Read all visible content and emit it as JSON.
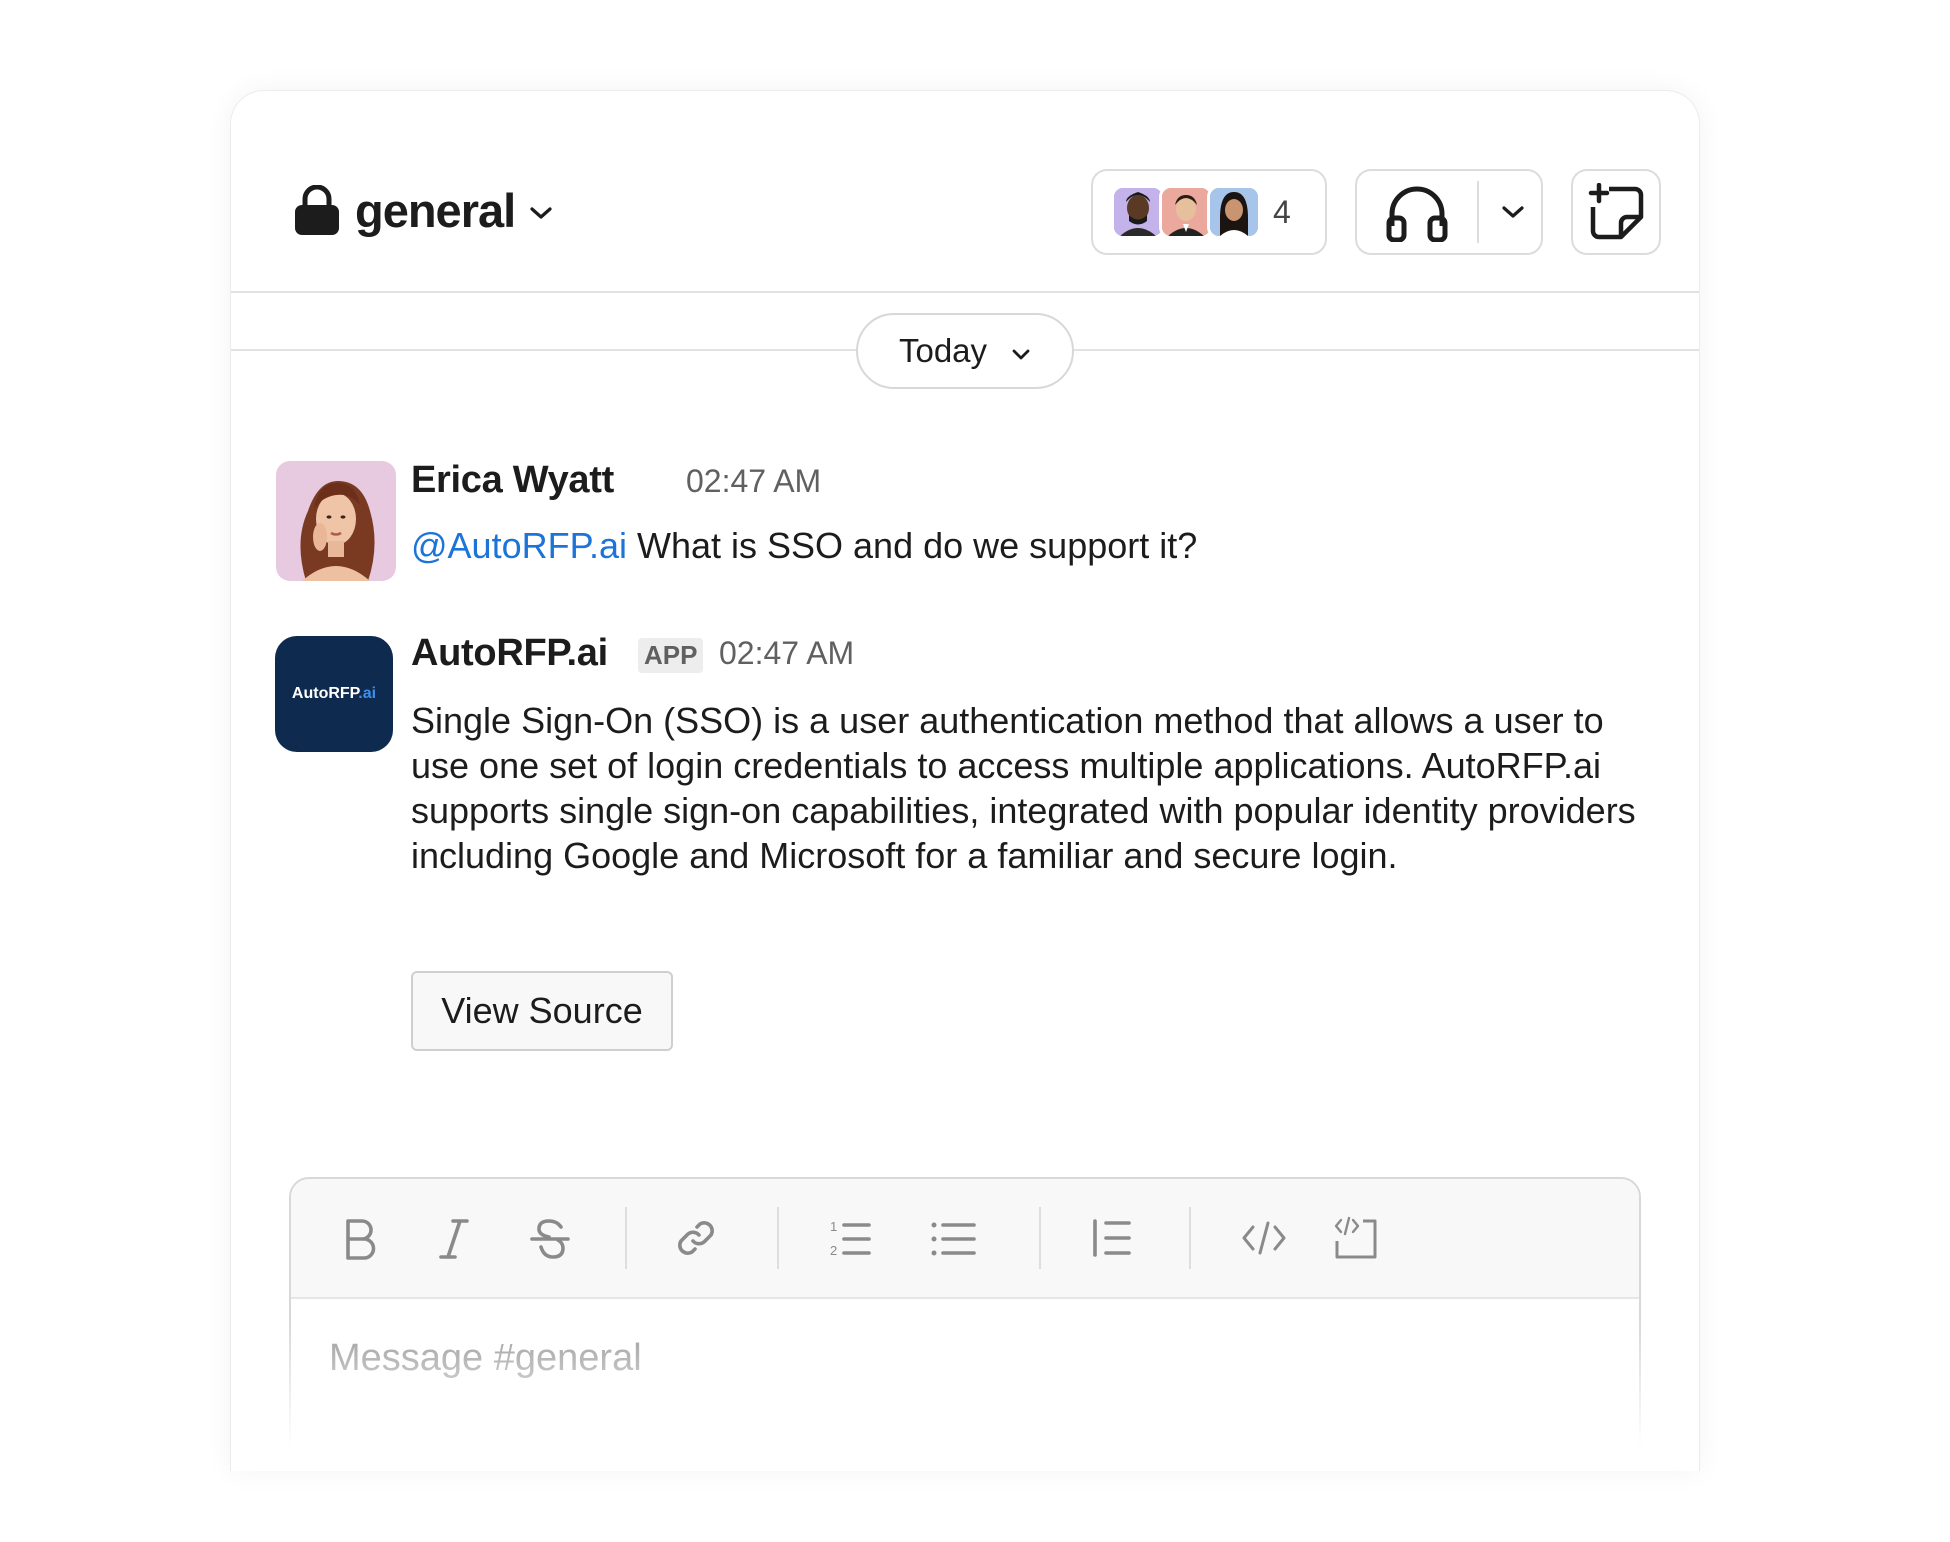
{
  "channel": {
    "name": "general",
    "icon": "lock-icon"
  },
  "members": {
    "count": "4"
  },
  "date_divider": {
    "label": "Today"
  },
  "messages": [
    {
      "author": "Erica Wyatt",
      "time": "02:47 AM",
      "mention": "@AutoRFP.ai",
      "text": " What is SSO and do we support it?"
    },
    {
      "author": "AutoRFP.ai",
      "badge": "APP",
      "time": "02:47 AM",
      "avatar_text": "AutoRFP",
      "avatar_text_accent": ".ai",
      "text": "Single Sign-On (SSO) is a user authentication method that allows a user to use one set of login credentials to access multiple applications. AutoRFP.ai supports single sign-on capabilities, integrated with popular identity providers including Google and Microsoft for a familiar and secure login.",
      "button": "View Source"
    }
  ],
  "composer": {
    "placeholder": "Message #general"
  },
  "colors": {
    "mention": "#1d74d8",
    "app_avatar_bg": "#0e2a4f",
    "text": "#1d1c1d"
  }
}
